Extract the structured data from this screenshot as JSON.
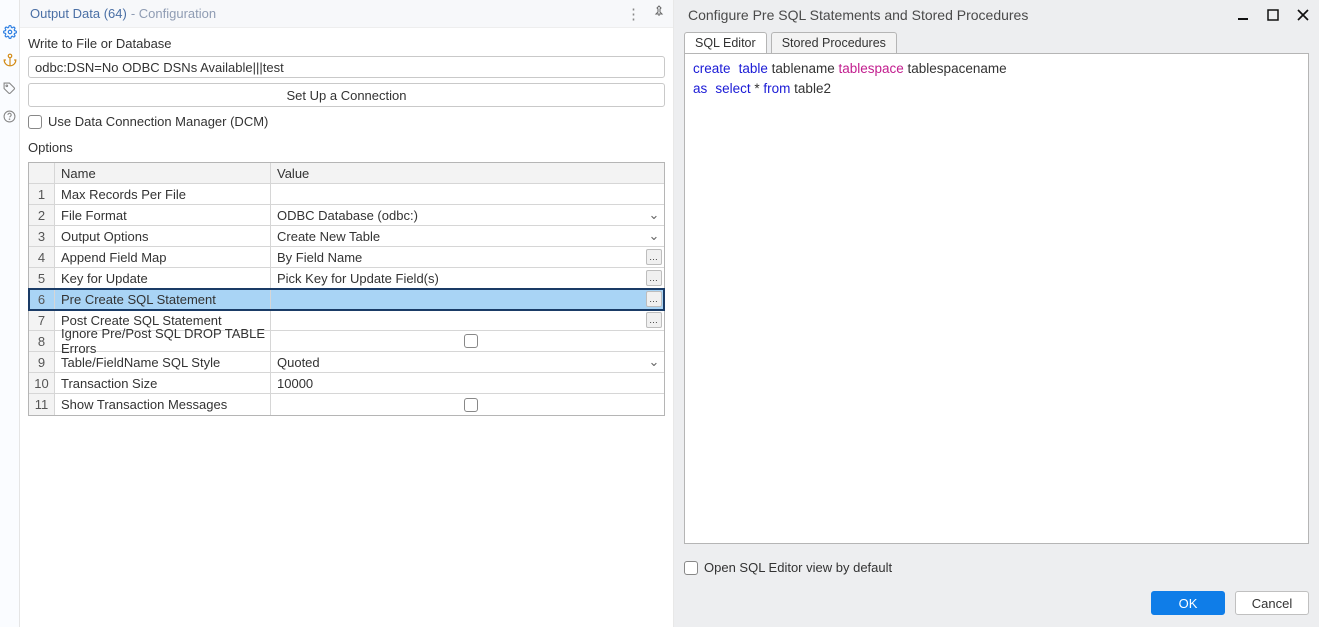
{
  "left": {
    "title": "Output Data (64)",
    "subtitle": " - Configuration",
    "write_label": "Write to File or Database",
    "conn_string": "odbc:DSN=No ODBC DSNs Available|||test",
    "setup_btn": "Set Up a Connection",
    "dcm_label": "Use Data Connection Manager (DCM)",
    "options_label": "Options",
    "headers": {
      "name": "Name",
      "value": "Value"
    }
  },
  "grid": [
    {
      "idx": "1",
      "name": "Max Records Per File",
      "value": "",
      "ctrl": "none"
    },
    {
      "idx": "2",
      "name": "File Format",
      "value": "ODBC Database (odbc:)",
      "ctrl": "dd"
    },
    {
      "idx": "3",
      "name": "Output Options",
      "value": "Create New Table",
      "ctrl": "dd"
    },
    {
      "idx": "4",
      "name": "Append Field Map",
      "value": "By Field Name",
      "ctrl": "ell"
    },
    {
      "idx": "5",
      "name": "Key for Update",
      "value": "Pick Key for Update Field(s)",
      "ctrl": "ell"
    },
    {
      "idx": "6",
      "name": "Pre Create SQL Statement",
      "value": "",
      "ctrl": "ell",
      "sel": true
    },
    {
      "idx": "7",
      "name": "Post Create SQL Statement",
      "value": "",
      "ctrl": "ell"
    },
    {
      "idx": "8",
      "name": "Ignore Pre/Post SQL DROP TABLE Errors",
      "value": "",
      "ctrl": "chk"
    },
    {
      "idx": "9",
      "name": "Table/FieldName SQL Style",
      "value": "Quoted",
      "ctrl": "dd"
    },
    {
      "idx": "10",
      "name": "Transaction Size",
      "value": "10000",
      "ctrl": "none"
    },
    {
      "idx": "11",
      "name": "Show Transaction Messages",
      "value": "",
      "ctrl": "chk"
    }
  ],
  "right": {
    "title": "Configure Pre SQL Statements and Stored Procedures",
    "tabs": [
      "SQL Editor",
      "Stored Procedures"
    ],
    "code": {
      "l1a": "create",
      "l1b": "table",
      "l1c": " tablename ",
      "l1d": "tablespace",
      "l1e": " tablespacename",
      "l2a": "as",
      "l2b": "select",
      "l2c": " * ",
      "l2d": "from",
      "l2e": " table2"
    },
    "open_default": "Open SQL Editor view by default",
    "ok": "OK",
    "cancel": "Cancel"
  }
}
